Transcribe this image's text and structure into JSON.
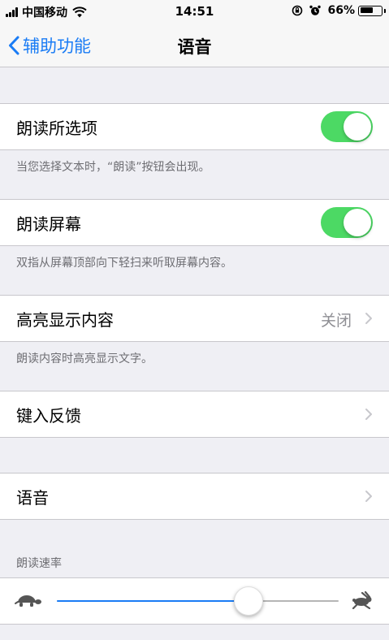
{
  "status_bar": {
    "carrier": "中国移动",
    "time": "14:51",
    "battery_percent": "66%",
    "battery_level": 0.66,
    "icons": [
      "signal-icon",
      "wifi-icon",
      "orientation-lock-icon",
      "alarm-icon",
      "battery-icon"
    ]
  },
  "nav": {
    "back_label": "辅助功能",
    "title": "语音"
  },
  "speak_selection": {
    "label": "朗读所选项",
    "enabled": true,
    "footnote": "当您选择文本时，“朗读”按钮会出现。"
  },
  "speak_screen": {
    "label": "朗读屏幕",
    "enabled": true,
    "footnote": "双指从屏幕顶部向下轻扫来听取屏幕内容。"
  },
  "highlight": {
    "label": "高亮显示内容",
    "value": "关闭",
    "footnote": "朗读内容时高亮显示文字。"
  },
  "typing_feedback": {
    "label": "键入反馈"
  },
  "voices": {
    "label": "语音"
  },
  "speaking_rate": {
    "header": "朗读速率",
    "value": 0.68
  },
  "colors": {
    "accent": "#1a7cf5",
    "toggle_on": "#4cd964",
    "background": "#efeff4",
    "secondary_text": "#6d6d72",
    "value_text": "#8e8e93"
  }
}
